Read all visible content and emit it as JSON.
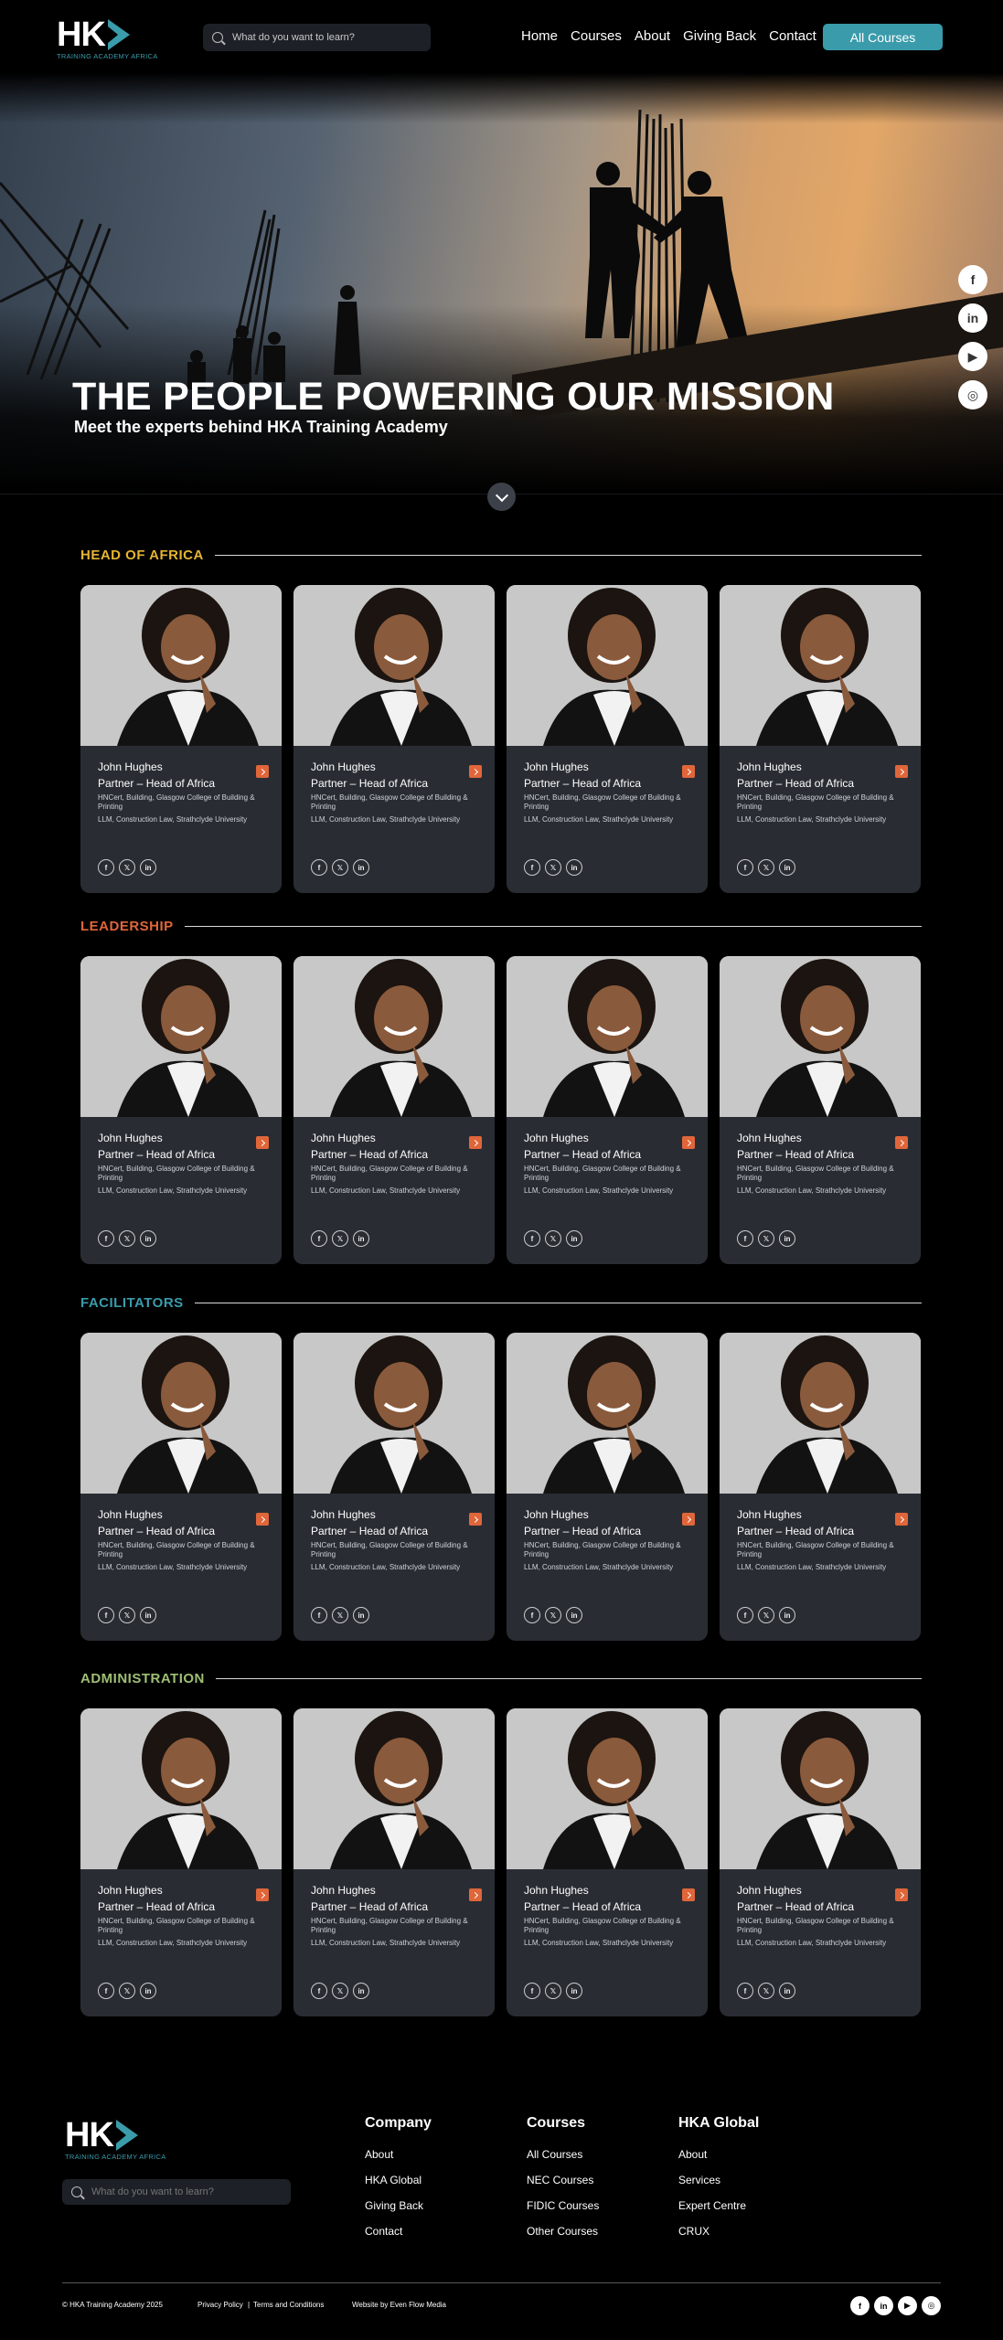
{
  "nav": {
    "logo_text": "HK",
    "logo_sub": "TRAINING ACADEMY AFRICA",
    "search_placeholder": "What do you want to learn?",
    "menu": [
      "Home",
      "Courses",
      "About",
      "Giving Back",
      "Contact"
    ],
    "cta": "All Courses"
  },
  "hero": {
    "title": "THE PEOPLE POWERING OUR MISSION",
    "subtitle": "Meet the experts behind HKA Training Academy",
    "side_social": [
      "facebook-icon",
      "linkedin-icon",
      "youtube-icon",
      "instagram-icon"
    ]
  },
  "sections": [
    {
      "title": "HEAD OF AFRICA",
      "color": "#e5b431"
    },
    {
      "title": "LEADERSHIP",
      "color": "#e0663a"
    },
    {
      "title": "FACILITATORS",
      "color": "#3a9bab"
    },
    {
      "title": "ADMINISTRATION",
      "color": "#9fbf73"
    }
  ],
  "person": {
    "name": "John Hughes",
    "role": "Partner – Head of Africa",
    "qual1": "HNCert, Building, Glasgow College of Building & Printing",
    "qual2": "LLM, Construction Law, Strathclyde University",
    "social": [
      "f",
      "𝕏",
      "in"
    ]
  },
  "footer": {
    "logo_text": "HK",
    "logo_sub": "TRAINING ACADEMY AFRICA",
    "search_placeholder": "What do you want to learn?",
    "columns": [
      {
        "title": "Company",
        "links": [
          "About",
          "HKA Global",
          "Giving Back",
          "Contact"
        ]
      },
      {
        "title": "Courses",
        "links": [
          "All Courses",
          "NEC Courses",
          "FIDIC Courses",
          "Other Courses"
        ]
      },
      {
        "title": "HKA Global",
        "links": [
          "About",
          "Services",
          "Expert Centre",
          "CRUX"
        ]
      }
    ],
    "copyright": "© HKA Training Academy 2025",
    "privacy": "Privacy Policy",
    "sep": "|",
    "terms": "Terms and Conditions",
    "credit": "Website by Even Flow Media",
    "social": [
      "f",
      "in",
      "▶",
      "◎"
    ]
  }
}
